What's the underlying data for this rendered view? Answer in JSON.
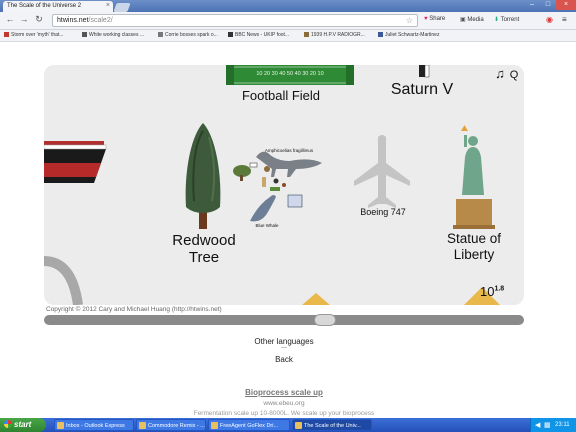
{
  "browser": {
    "tab_title": "The Scale of the Universe 2",
    "tab_close": "×",
    "window_controls": [
      "–",
      "□",
      "×"
    ],
    "url_host": "htwins.net",
    "url_path": "/scale2/",
    "star": "☆",
    "share_label": "Share",
    "media_label": "Media",
    "torrent_label": "Torrent"
  },
  "bookmarks": [
    {
      "label": "Storm over 'myth' that...",
      "color": "#c0392b"
    },
    {
      "label": "White working classes ...",
      "color": "#555555"
    },
    {
      "label": "Corrie bosses spark o...",
      "color": "#777777"
    },
    {
      "label": "BBC News - UKIP foot...",
      "color": "#333333"
    },
    {
      "label": "1939 H.P.V RADIOGR...",
      "color": "#8a6d3b"
    },
    {
      "label": "Juliet Schwartz-Martinez",
      "color": "#3b5998"
    }
  ],
  "scene": {
    "football_field_label": "Football Field",
    "football_markings": "10 20 30 40 50 40 30 20 10",
    "saturn_label": "Saturn V",
    "music_icon": "♫",
    "quality_label": "Q",
    "redwood_label_1": "Redwood",
    "redwood_label_2": "Tree",
    "amphicoelias_label": "Amphicoelias fragillimus",
    "blue_whale_label": "Blue Whale",
    "boeing_label": "Boeing 747",
    "statue_label_1": "Statue of",
    "statue_label_2": "Liberty",
    "scale_base": "10",
    "scale_exponent": "1.8"
  },
  "copyright": "Copyright © 2012 Cary and Michael Huang (http://htwins.net)",
  "slider": {
    "position_fraction": 0.59
  },
  "links": {
    "other_languages": "Other languages",
    "separator": "—",
    "back": "Back",
    "bioprocess": "Bioprocess scale up",
    "bioprocess_url": "www.ebeu.org",
    "bioprocess_desc": "Fermentation scale up 10-8000L. We scale up your bioprocess"
  },
  "taskbar": {
    "start_label": "start",
    "items": [
      {
        "label": "Inbox - Outlook Express",
        "active": false
      },
      {
        "label": "Commodore Remix - ...",
        "active": false
      },
      {
        "label": "FreeAgent GoFlex Dri...",
        "active": false
      },
      {
        "label": "The Scale of the Univ...",
        "active": true
      }
    ],
    "clock": "23:11"
  }
}
